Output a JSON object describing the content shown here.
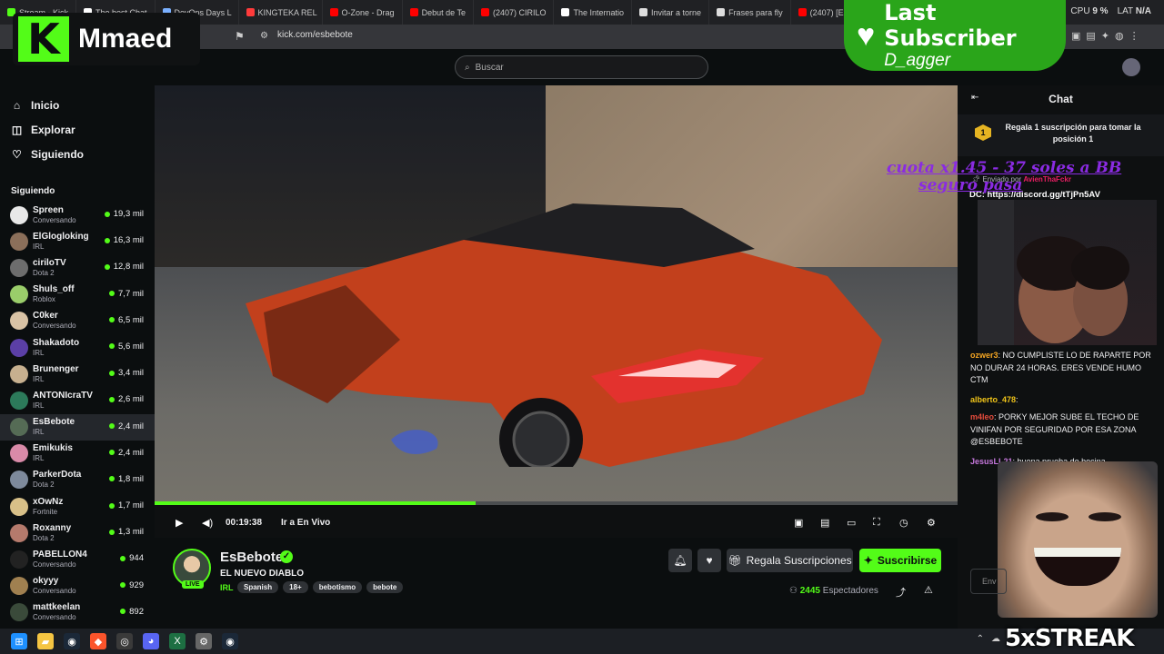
{
  "browser": {
    "tabs": [
      {
        "label": "Stream - Kick",
        "color": "#53fc18"
      },
      {
        "label": "The best Chat",
        "color": "#ffffff"
      },
      {
        "label": "DevOps Days L",
        "color": "#7ab0ff"
      },
      {
        "label": "KINGTEKA REL",
        "color": "#ff3b3b"
      },
      {
        "label": "O-Zone - Drag",
        "color": "#ff0000"
      },
      {
        "label": "Debut de Te",
        "color": "#ff0000"
      },
      {
        "label": "(2407) CIRILO",
        "color": "#ff0000"
      },
      {
        "label": "The Internatio",
        "color": "#ffffff"
      },
      {
        "label": "Invitar a torne",
        "color": "#dddddd"
      },
      {
        "label": "Frases para fly",
        "color": "#dddddd"
      },
      {
        "label": "(2407) [ES",
        "color": "#ff0000"
      }
    ],
    "url": "kick.com/esbebote",
    "cpu_label": "CPU",
    "cpu_value": "9 %",
    "lat_label": "LAT",
    "lat_value": "N/A"
  },
  "overlay": {
    "brand_name": "Mmaed",
    "brand_letter": "K",
    "last_sub_title": "Last Subscriber",
    "last_sub_name": "D_agger",
    "donation_text_1": "cuota x1.45 - 37 soles a BB",
    "donation_text_2": "seguro pasa",
    "streak": "5xSTREAK"
  },
  "topbar": {
    "search_placeholder": "Buscar"
  },
  "sidebar": {
    "nav": [
      {
        "label": "Inicio",
        "icon": "home-icon",
        "glyph": "⌂"
      },
      {
        "label": "Explorar",
        "icon": "compass-icon",
        "glyph": "◫"
      },
      {
        "label": "Siguiendo",
        "icon": "heart-icon",
        "glyph": "♡"
      }
    ],
    "following_title": "Siguiendo",
    "channels": [
      {
        "name": "Spreen",
        "category": "Conversando",
        "viewers": "19,3 mil",
        "color": "#e8e8e8"
      },
      {
        "name": "ElGlogloking",
        "category": "IRL",
        "viewers": "16,3 mil",
        "color": "#8b6f5a"
      },
      {
        "name": "ciriloTV",
        "category": "Dota 2",
        "viewers": "12,8 mil",
        "color": "#6d6d6d"
      },
      {
        "name": "Shuls_off",
        "category": "Roblox",
        "viewers": "7,7 mil",
        "color": "#9acd6a"
      },
      {
        "name": "C0ker",
        "category": "Conversando",
        "viewers": "6,5 mil",
        "color": "#d9c3a5"
      },
      {
        "name": "Shakadoto",
        "category": "IRL",
        "viewers": "5,6 mil",
        "color": "#5b3fa6"
      },
      {
        "name": "Brunenger",
        "category": "IRL",
        "viewers": "3,4 mil",
        "color": "#c7b08f"
      },
      {
        "name": "ANTONIcraTV",
        "category": "IRL",
        "viewers": "2,6 mil",
        "color": "#2c7a5a"
      },
      {
        "name": "EsBebote",
        "category": "IRL",
        "viewers": "2,4 mil",
        "color": "#556b55"
      },
      {
        "name": "Emikukis",
        "category": "IRL",
        "viewers": "2,4 mil",
        "color": "#d98aa8"
      },
      {
        "name": "ParkerDota",
        "category": "Dota 2",
        "viewers": "1,8 mil",
        "color": "#7e8a9c"
      },
      {
        "name": "xOwNz",
        "category": "Fortnite",
        "viewers": "1,7 mil",
        "color": "#d8c088"
      },
      {
        "name": "Roxanny",
        "category": "Dota 2",
        "viewers": "1,3 mil",
        "color": "#b57a6c"
      },
      {
        "name": "PABELLON4",
        "category": "Conversando",
        "viewers": "944",
        "color": "#222222"
      },
      {
        "name": "okyyy",
        "category": "Conversando",
        "viewers": "929",
        "color": "#a08050"
      },
      {
        "name": "mattkeelan",
        "category": "Conversando",
        "viewers": "892",
        "color": "#3a4a3a"
      }
    ]
  },
  "player": {
    "time": "00:19:38",
    "go_live": "Ir a En Vivo",
    "progress": 0.4
  },
  "stream": {
    "name": "EsBebote",
    "title": "EL NUEVO DIABLO",
    "category": "IRL",
    "tags": [
      "Spanish",
      "18+",
      "bebotismo",
      "bebote"
    ],
    "live_badge": "LIVE",
    "gift_label": "Regala Suscripciones",
    "subscribe_label": "Suscribirse",
    "viewers_count": "2445",
    "viewers_label": "Espectadores"
  },
  "chat": {
    "title": "Chat",
    "pinned_rank": "1",
    "pinned_text": "Regala 1 suscripción para tomar la posición 1",
    "sent_by_label": "Enviado por",
    "sent_by_user": "AvienThaFckr",
    "dc_link": "DC: https://discord.gg/tTjPn5AV",
    "messages": [
      {
        "user": "ozwer3",
        "user_color": "#f5a623",
        "text": "NO CUMPLISTE LO DE RAPARTE POR NO DURAR 24 HORAS. ERES VENDE HUMO CTM"
      },
      {
        "user": "alberto_478",
        "user_color": "#f0c419",
        "text": ""
      },
      {
        "user": "m4leo",
        "user_color": "#e74c3c",
        "text": "PORKY MEJOR SUBE EL TECHO DE VINIFAN POR SEGURIDAD POR ESA ZONA @ESBEBOTE"
      },
      {
        "user": "JesusLL21",
        "user_color": "#c678dd",
        "text": "buena prueba de bocina"
      }
    ],
    "input_placeholder": "Env"
  },
  "taskbar": {
    "icons": [
      "windows-icon",
      "file-explorer-icon",
      "steam-icon",
      "brave-icon",
      "obs-icon",
      "discord-icon",
      "excel-icon",
      "settings-icon",
      "steam-alt-icon"
    ]
  }
}
